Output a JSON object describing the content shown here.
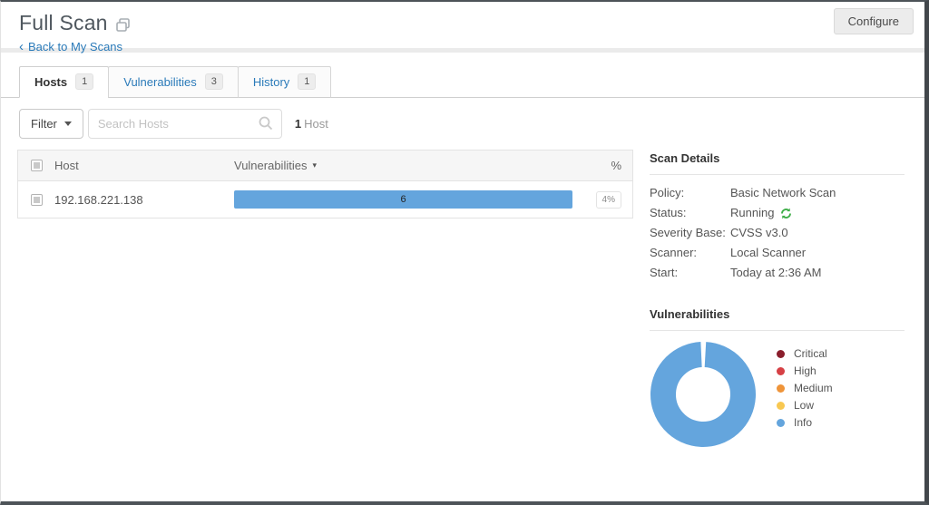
{
  "header": {
    "title": "Full Scan",
    "back_link": "Back to My Scans",
    "configure_label": "Configure"
  },
  "tabs": [
    {
      "label": "Hosts",
      "badge": "1"
    },
    {
      "label": "Vulnerabilities",
      "badge": "3"
    },
    {
      "label": "History",
      "badge": "1"
    }
  ],
  "toolbar": {
    "filter_label": "Filter",
    "search_placeholder": "Search Hosts",
    "count_value": "1",
    "count_label": "Host"
  },
  "table": {
    "columns": {
      "host": "Host",
      "vulnerabilities": "Vulnerabilities",
      "percent": "%"
    },
    "rows": [
      {
        "host": "192.168.221.138",
        "bar_label": "6",
        "bar_color": "#64a5dd",
        "percent": "4%"
      }
    ]
  },
  "scan_details": {
    "title": "Scan Details",
    "rows": [
      {
        "label": "Policy:",
        "value": "Basic Network Scan"
      },
      {
        "label": "Status:",
        "value": "Running"
      },
      {
        "label": "Severity Base:",
        "value": "CVSS v3.0"
      },
      {
        "label": "Scanner:",
        "value": "Local Scanner"
      },
      {
        "label": "Start:",
        "value": "Today at 2:36 AM"
      }
    ],
    "status_icon_color": "#3fae49"
  },
  "vulnerabilities_panel": {
    "title": "Vulnerabilities",
    "legend": [
      {
        "label": "Critical",
        "color": "#8a1e2c"
      },
      {
        "label": "High",
        "color": "#d64045"
      },
      {
        "label": "Medium",
        "color": "#ef9439"
      },
      {
        "label": "Low",
        "color": "#f8c851"
      },
      {
        "label": "Info",
        "color": "#64a5dd"
      }
    ]
  },
  "chart_data": {
    "type": "pie",
    "donut": true,
    "title": "Vulnerabilities",
    "categories": [
      "Critical",
      "High",
      "Medium",
      "Low",
      "Info"
    ],
    "values": [
      0,
      0,
      0,
      0,
      6
    ],
    "colors": [
      "#8a1e2c",
      "#d64045",
      "#ef9439",
      "#f8c851",
      "#64a5dd"
    ],
    "legend_position": "right"
  }
}
